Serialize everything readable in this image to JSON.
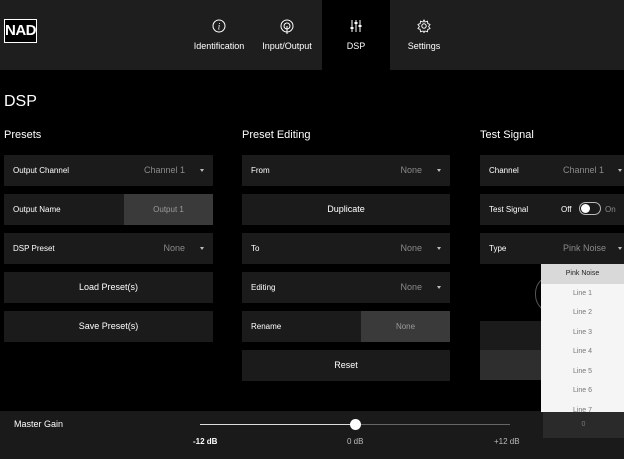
{
  "brand": {
    "logo_text": "NAD"
  },
  "nav": {
    "tabs": [
      {
        "label": "Identification",
        "icon": "info-icon"
      },
      {
        "label": "Input/Output",
        "icon": "input-output-icon"
      },
      {
        "label": "DSP",
        "icon": "sliders-icon",
        "active": true
      },
      {
        "label": "Settings",
        "icon": "gear-icon"
      }
    ]
  },
  "page": {
    "title": "DSP"
  },
  "presets": {
    "title": "Presets",
    "output_channel": {
      "label": "Output Channel",
      "value": "Channel 1"
    },
    "output_name": {
      "label": "Output Name",
      "value": "Output 1"
    },
    "dsp_preset": {
      "label": "DSP Preset",
      "value": "None"
    },
    "load_button": "Load Preset(s)",
    "save_button": "Save Preset(s)"
  },
  "preset_editing": {
    "title": "Preset Editing",
    "from": {
      "label": "From",
      "value": "None"
    },
    "duplicate_button": "Duplicate",
    "to": {
      "label": "To",
      "value": "None"
    },
    "editing": {
      "label": "Editing",
      "value": "None"
    },
    "rename": {
      "label": "Rename",
      "placeholder": "None"
    },
    "reset_button": "Reset"
  },
  "test_signal": {
    "title": "Test Signal",
    "channel": {
      "label": "Channel",
      "value": "Channel 1"
    },
    "toggle": {
      "label": "Test Signal",
      "off_label": "Off",
      "on_label": "On",
      "state": "off"
    },
    "type": {
      "label": "Type",
      "value": "Pink Noise"
    },
    "type_options": [
      "Pink Noise",
      "Line 1",
      "Line 2",
      "Line 3",
      "Line 4",
      "Line 5",
      "Line 6",
      "Line 7"
    ],
    "level_value": "0"
  },
  "master_gain": {
    "label": "Master Gain",
    "min_label": "-12 dB",
    "mid_label": "0 dB",
    "max_label": "+12 dB",
    "min_db": -12,
    "max_db": 12,
    "value_db": 0
  },
  "colors": {
    "background": "#000000",
    "panel": "#1b1b1b",
    "topbar": "#1e1e1e",
    "muted_text": "#8a8a8a",
    "dropdown_bg": "#f5f5f5"
  }
}
